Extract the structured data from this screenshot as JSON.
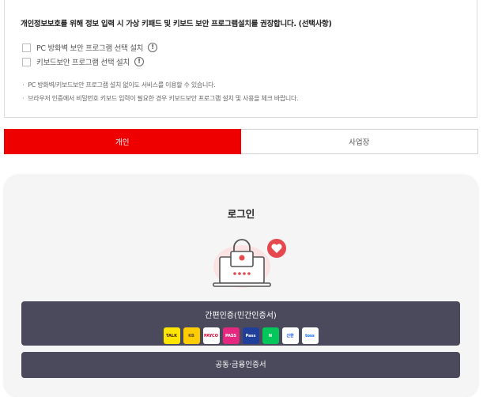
{
  "notice": {
    "title": "개인정보보호를 위해 정보 입력 시 가상 키패드 및 키보드 보안 프로그램설치를 권장합니다. (선택사항)",
    "options": [
      {
        "label": "PC 방화벽 보안 프로그램 선택 설치",
        "checked": false
      },
      {
        "label": "키보드보안 프로그램 선택 설치",
        "checked": false
      }
    ],
    "info_glyph": "!",
    "notes": [
      "PC 방화벽/키보드보안 프로그램 설치 없이도 서비스를 이용할 수 있습니다.",
      "브라우저 인증에서 비밀번호 키보드 입력이 필요한 경우 키보드보안 프로그램 설치 및 사용을 체크 바랍니다."
    ],
    "bullet": "·"
  },
  "tabs": [
    {
      "label": "개인",
      "active": true
    },
    {
      "label": "사업장",
      "active": false
    }
  ],
  "login": {
    "title": "로그인",
    "easy_auth_label": "간편인증(민간인증서)",
    "providers": [
      {
        "name": "kakao-icon",
        "text": "TALK",
        "bg": "#fee500",
        "fg": "#3a1d1d"
      },
      {
        "name": "kb-icon",
        "text": "KB",
        "bg": "#ffcc00",
        "fg": "#5a4a2a"
      },
      {
        "name": "payco-icon",
        "text": "PAYCO",
        "bg": "#ffffff",
        "fg": "#e5002b"
      },
      {
        "name": "pass-icon",
        "text": "PASS",
        "bg": "#e5287f",
        "fg": "#ffffff"
      },
      {
        "name": "pass-samsung-icon",
        "text": "Pass",
        "bg": "#1f3f9a",
        "fg": "#ffffff"
      },
      {
        "name": "naver-icon",
        "text": "N",
        "bg": "#03c75a",
        "fg": "#ffffff"
      },
      {
        "name": "shinhan-icon",
        "text": "신한",
        "bg": "#ffffff",
        "fg": "#0046ff"
      },
      {
        "name": "toss-icon",
        "text": "toss",
        "bg": "#ffffff",
        "fg": "#0064ff"
      }
    ],
    "cert_label": "공동·금융인증서"
  },
  "colors": {
    "accent": "#ee0000",
    "button_bg": "#4a4a5c"
  }
}
